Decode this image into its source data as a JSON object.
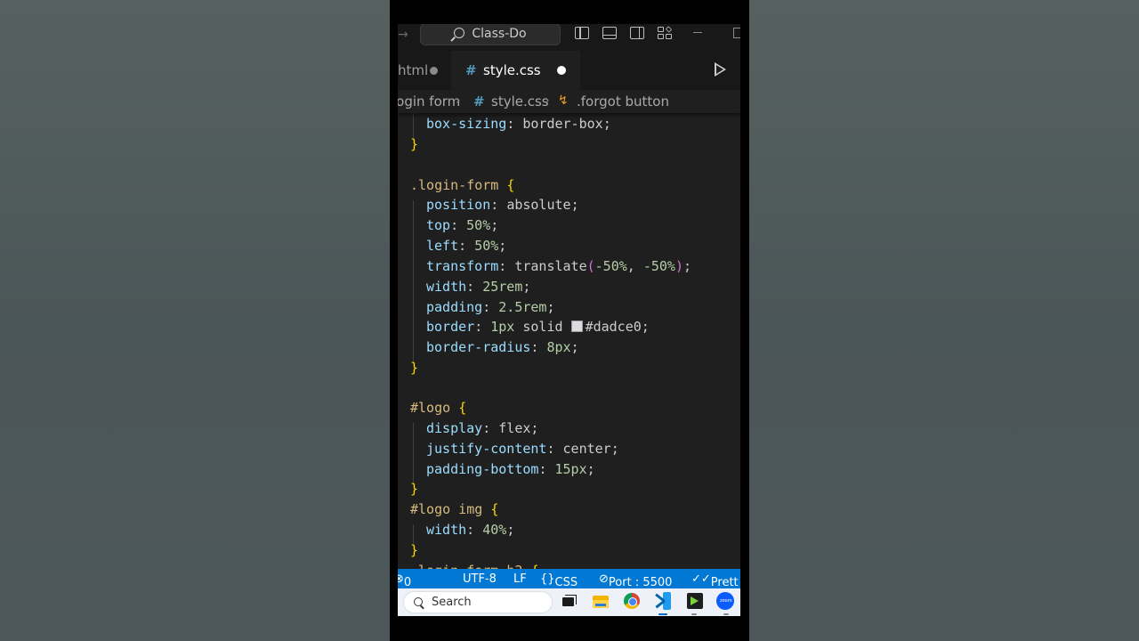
{
  "titlebar": {
    "command_center_label": "Class-Do"
  },
  "tabs": [
    {
      "label": "html",
      "active": false,
      "dirty": true
    },
    {
      "label": "style.css",
      "active": true,
      "dirty": true
    }
  ],
  "breadcrumb": {
    "folder": "login form",
    "file": "style.css",
    "symbol": ".forgot button"
  },
  "editor": {
    "lines": [
      {
        "sel": "}",
        "kind": "brace"
      },
      {
        "sel": ".login-form {",
        "kind": "rule"
      },
      {
        "prop": "position",
        "value": "absolute"
      },
      {
        "prop": "top",
        "value": "50%"
      },
      {
        "prop": "left",
        "value": "50%"
      },
      {
        "prop": "transform",
        "value": "translate(-50%, -50%)"
      },
      {
        "prop": "width",
        "value": "25rem"
      },
      {
        "prop": "padding",
        "value": "2.5rem"
      },
      {
        "prop": "border",
        "value": "1px solid #dadce0"
      },
      {
        "prop": "border-radius",
        "value": "8px"
      },
      {
        "sel": "#logo {",
        "kind": "rule"
      },
      {
        "prop": "display",
        "value": "flex"
      },
      {
        "prop": "justify-content",
        "value": "center"
      },
      {
        "prop": "padding-bottom",
        "value": "15px"
      },
      {
        "sel": "#logo img {",
        "kind": "rule"
      },
      {
        "prop": "width",
        "value": "40%"
      }
    ],
    "first_visible": {
      "prop": "box-sizing",
      "value": "border-box"
    },
    "swatch_color": "#dadce0"
  },
  "statusbar": {
    "errors": "0",
    "encoding": "UTF-8",
    "eol": "LF",
    "language": "CSS",
    "port": "Port : 5500",
    "prettier": "Prett",
    "color": "#0078d4"
  },
  "taskbar": {
    "search_placeholder": "Search",
    "icons": [
      "task-view-icon",
      "file-explorer-icon",
      "chrome-icon",
      "vscode-icon",
      "terminal-app-icon",
      "zoom-icon"
    ]
  }
}
